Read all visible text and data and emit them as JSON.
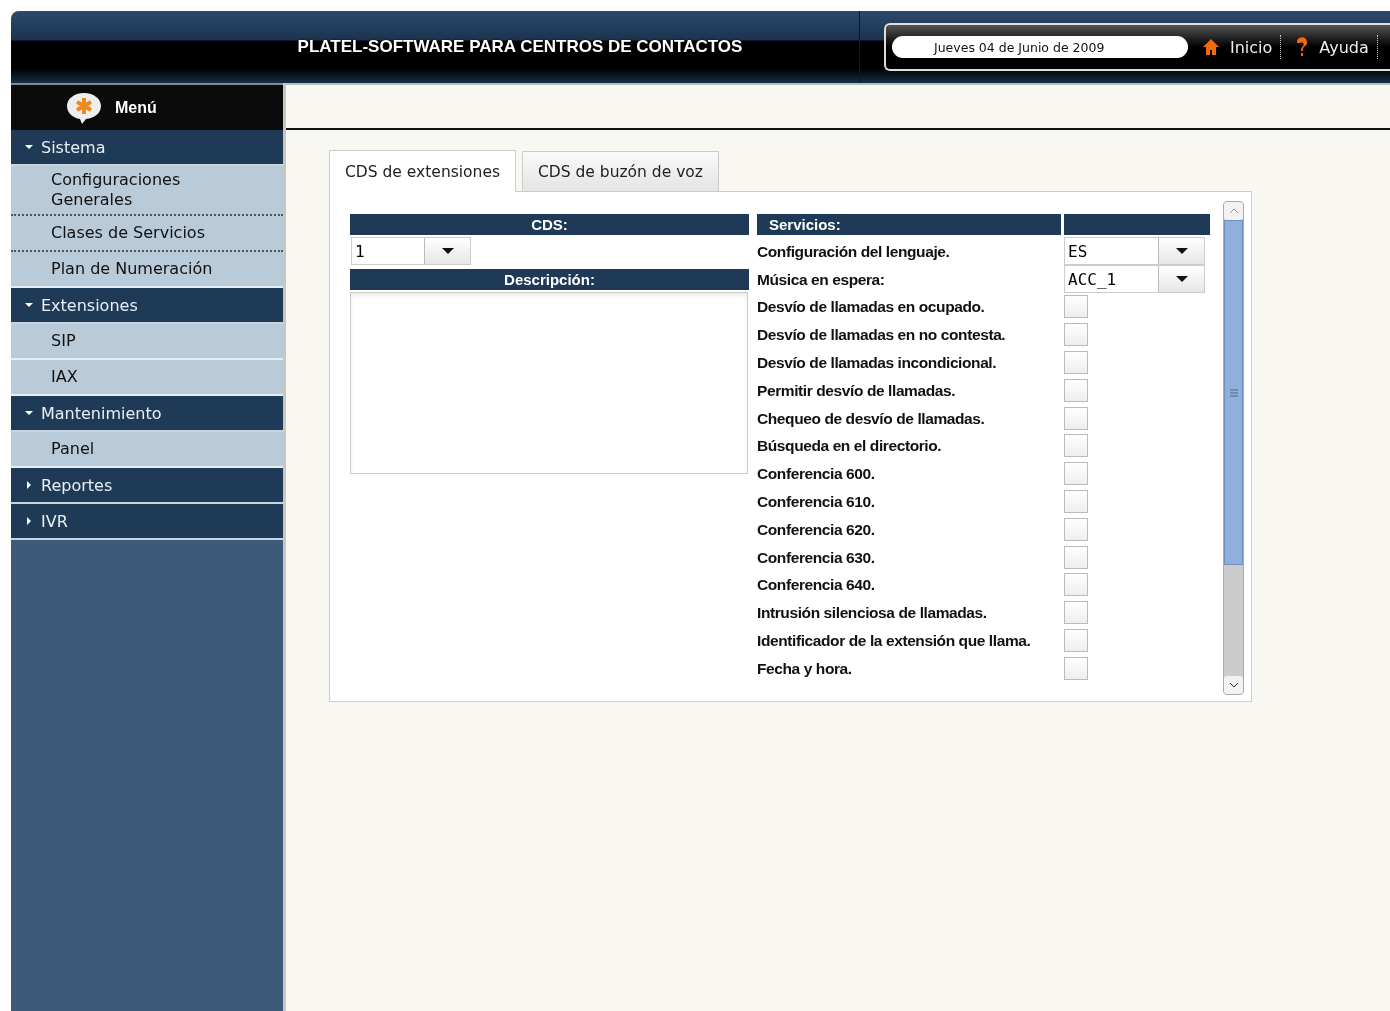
{
  "header": {
    "title": "PLATEL-SOFTWARE PARA CENTROS DE CONTACTOS",
    "date": "Jueves 04 de Junio de 2009",
    "links": [
      {
        "label": "Inicio",
        "kind": "home"
      },
      {
        "label": "Ayuda",
        "kind": "help"
      }
    ]
  },
  "sidebar": {
    "title": "Menú",
    "groups": [
      {
        "label": "Sistema",
        "expanded": true,
        "children": [
          {
            "label": "Configuraciones Generales"
          },
          {
            "label": "Clases de Servicios"
          },
          {
            "label": "Plan de Numeración"
          }
        ]
      },
      {
        "label": "Extensiones",
        "expanded": true,
        "children": [
          {
            "label": "SIP"
          },
          {
            "label": "IAX"
          }
        ]
      },
      {
        "label": "Mantenimiento",
        "expanded": true,
        "children": [
          {
            "label": "Panel"
          }
        ]
      },
      {
        "label": "Reportes",
        "expanded": false
      },
      {
        "label": "IVR",
        "expanded": false
      }
    ]
  },
  "tabs": [
    {
      "label": "CDS de extensiones",
      "selected": true
    },
    {
      "label": "CDS de buzón de voz",
      "selected": false
    }
  ],
  "form": {
    "cds_label": "CDS:",
    "cds_value": "1",
    "description_label": "Descripción:",
    "services_label": "Servicios:",
    "services": [
      {
        "label": "Configuración del lenguaje.",
        "kind": "select",
        "value": "ES"
      },
      {
        "label": "Música en espera:",
        "kind": "select",
        "value": "ACC_1"
      },
      {
        "label": "Desvío de llamadas en ocupado.",
        "kind": "checkbox",
        "checked": false
      },
      {
        "label": "Desvío de llamadas en no contesta.",
        "kind": "checkbox",
        "checked": false
      },
      {
        "label": "Desvío de llamadas incondicional.",
        "kind": "checkbox",
        "checked": false
      },
      {
        "label": "Permitir desvío de llamadas.",
        "kind": "checkbox",
        "checked": false
      },
      {
        "label": "Chequeo de desvío de llamadas.",
        "kind": "checkbox",
        "checked": false
      },
      {
        "label": "Búsqueda en el directorio.",
        "kind": "checkbox",
        "checked": false
      },
      {
        "label": "Conferencia 600.",
        "kind": "checkbox",
        "checked": false
      },
      {
        "label": "Conferencia 610.",
        "kind": "checkbox",
        "checked": false
      },
      {
        "label": "Conferencia 620.",
        "kind": "checkbox",
        "checked": false
      },
      {
        "label": "Conferencia 630.",
        "kind": "checkbox",
        "checked": false
      },
      {
        "label": "Conferencia 640.",
        "kind": "checkbox",
        "checked": false
      },
      {
        "label": "Intrusión silenciosa de llamadas.",
        "kind": "checkbox",
        "checked": false
      },
      {
        "label": "Identificador de la extensión que llama.",
        "kind": "checkbox",
        "checked": false
      },
      {
        "label": "Fecha y hora.",
        "kind": "checkbox",
        "checked": false
      }
    ]
  }
}
